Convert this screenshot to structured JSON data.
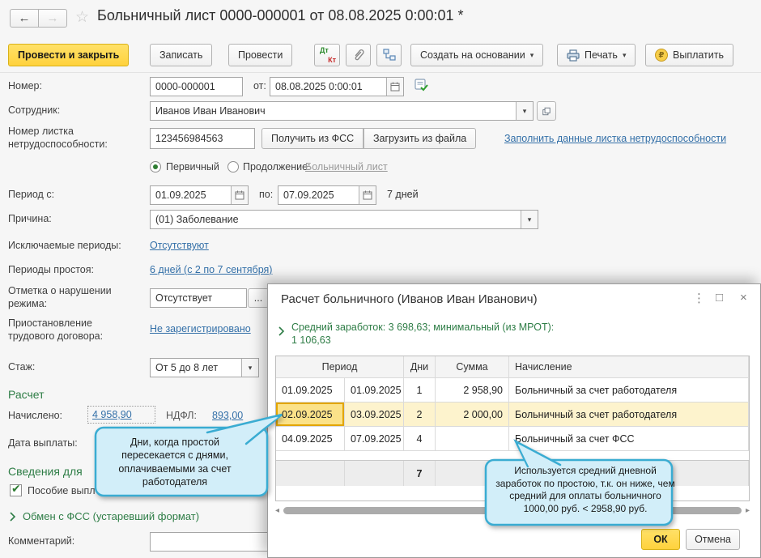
{
  "window": {
    "title": "Больничный лист 0000-000001 от 08.08.2025 0:00:01 *"
  },
  "icons": {
    "back": "←",
    "forward": "→",
    "star": "☆",
    "dropdown": "▾",
    "more": "...",
    "menu": "⋮",
    "maximize": "□",
    "close": "×",
    "scroll_left": "◂",
    "scroll_right": "▸",
    "check": "✔",
    "dt": "Дт",
    "kt": "Кт",
    "ruble": "₽"
  },
  "toolbar": {
    "post_and_close": "Провести и закрыть",
    "save": "Записать",
    "post": "Провести",
    "create_on_basis": "Создать на основании",
    "print": "Печать",
    "pay": "Выплатить"
  },
  "form": {
    "number": {
      "label": "Номер:",
      "value": "0000-000001",
      "from_label": "от:",
      "date_value": "08.08.2025  0:00:01"
    },
    "employee": {
      "label": "Сотрудник:",
      "value": "Иванов Иван Иванович"
    },
    "sick_list": {
      "label": "Номер листка нетрудоспособности:",
      "value": "123456984563",
      "get_from_fss": "Получить из ФСС",
      "load_from_file": "Загрузить из файла",
      "fill_link": "Заполнить данные листка нетрудоспособности"
    },
    "primary_radio": "Первичный",
    "continuation_radio": "Продолжение:",
    "continuation_link": "Больничный лист",
    "period": {
      "label": "Период с:",
      "from": "01.09.2025",
      "to_label": "по:",
      "to": "07.09.2025",
      "days": "7 дней"
    },
    "reason": {
      "label": "Причина:",
      "value": "(01) Заболевание"
    },
    "excluded": {
      "label": "Исключаемые периоды:",
      "value": "Отсутствуют"
    },
    "downtime": {
      "label": "Периоды простоя:",
      "value": "6 дней (с 2 по 7 сентября)"
    },
    "violation": {
      "label": "Отметка о нарушении режима:",
      "value": "Отсутствует"
    },
    "suspension": {
      "label": "Приостановление трудового договора:",
      "value": "Не зарегистрировано"
    },
    "experience": {
      "label": "Стаж:",
      "value": "От 5 до 8 лет"
    },
    "calc_heading": "Расчет",
    "accrued": {
      "label": "Начислено:",
      "value": "4 958,90",
      "ndfl_label": "НДФЛ:",
      "ndfl_value": "893,00"
    },
    "pay_date_label": "Дата выплаты:",
    "info_heading": "Сведения для",
    "benefit_checkbox": "Пособие выпл",
    "fss_exchange": "Обмен с ФСС (устаревший формат)",
    "comment_label": "Комментарий:"
  },
  "dialog": {
    "title": "Расчет больничного (Иванов Иван Иванович)",
    "avg_line1": "Средний заработок: 3 698,63; минимальный (из МРОТ):",
    "avg_line2": "1 106,63",
    "table": {
      "headers": {
        "period": "Период",
        "days": "Дни",
        "amount": "Сумма",
        "accrual": "Начисление"
      },
      "rows": [
        {
          "from": "01.09.2025",
          "to": "01.09.2025",
          "days": "1",
          "amount": "2 958,90",
          "accrual": "Больничный за счет работодателя"
        },
        {
          "from": "02.09.2025",
          "to": "03.09.2025",
          "days": "2",
          "amount": "2 000,00",
          "accrual": "Больничный за счет работодателя"
        },
        {
          "from": "04.09.2025",
          "to": "07.09.2025",
          "days": "4",
          "amount": "",
          "accrual": "Больничный за счет ФСС"
        }
      ],
      "total_days": "7"
    },
    "ok": "ОК",
    "cancel": "Отмена"
  },
  "callouts": {
    "left": {
      "lines": [
        "Дни, когда простой",
        "пересекается с днями,",
        "оплачиваемыми за счет",
        "работодателя"
      ]
    },
    "right": {
      "lines": [
        "Используется средний дневной",
        "заработок по простою, т.к. он ниже, чем",
        "средний для оплаты больничного",
        "1000,00 руб. <  2958,90 руб."
      ]
    }
  },
  "colors": {
    "accent_yellow": "#ffd23d",
    "green": "#2e7d46",
    "link_blue": "#3470a8",
    "callout_fill": "#d2eef9",
    "callout_border": "#3aacd2",
    "selected_cell": "#fbe289",
    "selected_row": "#fdf3cd"
  }
}
